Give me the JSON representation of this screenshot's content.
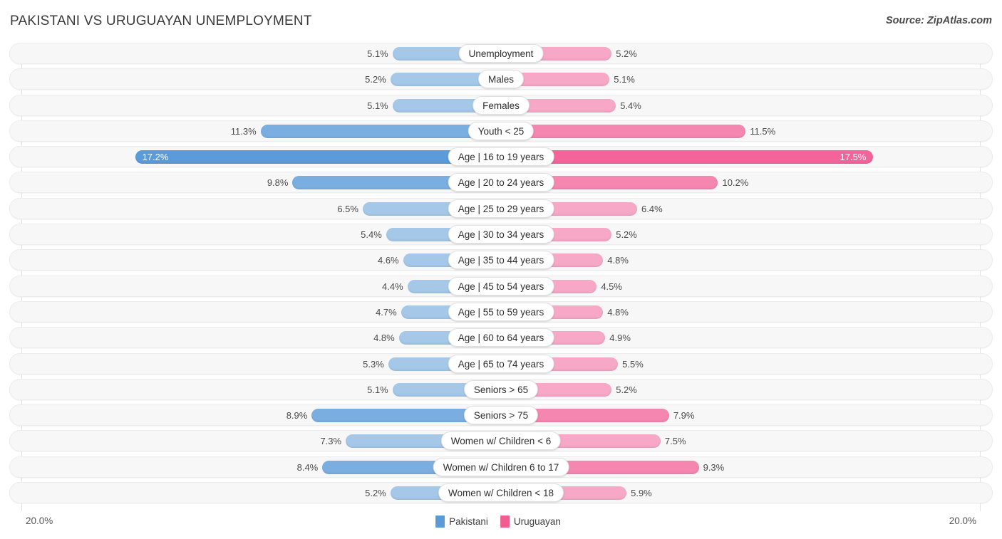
{
  "header": {
    "title": "PAKISTANI VS URUGUAYAN UNEMPLOYMENT",
    "source": "Source: ZipAtlas.com"
  },
  "axis": {
    "left_label": "20.0%",
    "right_label": "20.0%",
    "max": 20.0
  },
  "legend": {
    "items": [
      {
        "label": "Pakistani",
        "color": "#5b9bd5"
      },
      {
        "label": "Uruguayan",
        "color": "#ee5e8e"
      }
    ]
  },
  "colors": {
    "blue_light": "#a5c8e8",
    "blue_mid": "#7baee0",
    "blue_dark": "#5b9bd9",
    "pink_light": "#f6a8c6",
    "pink_mid": "#f486b0",
    "pink_dark": "#f2649a",
    "track": "#f7f7f7",
    "gridline": "#e3e3e3"
  },
  "chart_data": {
    "type": "bar",
    "orientation": "horizontal-diverging",
    "title": "PAKISTANI VS URUGUAYAN UNEMPLOYMENT",
    "xlabel": "",
    "ylabel": "",
    "xlim": [
      -20.0,
      20.0
    ],
    "grid": true,
    "legend_position": "bottom-center",
    "series": [
      {
        "name": "Pakistani",
        "side": "left",
        "color": "#5b9bd5",
        "values": [
          5.1,
          5.2,
          5.1,
          11.3,
          17.2,
          9.8,
          6.5,
          5.4,
          4.6,
          4.4,
          4.7,
          4.8,
          5.3,
          5.1,
          8.9,
          7.3,
          8.4,
          5.2
        ]
      },
      {
        "name": "Uruguayan",
        "side": "right",
        "color": "#ee5e8e",
        "values": [
          5.2,
          5.1,
          5.4,
          11.5,
          17.5,
          10.2,
          6.4,
          5.2,
          4.8,
          4.5,
          4.8,
          4.9,
          5.5,
          5.2,
          7.9,
          7.5,
          9.3,
          5.9
        ]
      }
    ],
    "categories": [
      "Unemployment",
      "Males",
      "Females",
      "Youth < 25",
      "Age | 16 to 19 years",
      "Age | 20 to 24 years",
      "Age | 25 to 29 years",
      "Age | 30 to 34 years",
      "Age | 35 to 44 years",
      "Age | 45 to 54 years",
      "Age | 55 to 59 years",
      "Age | 60 to 64 years",
      "Age | 65 to 74 years",
      "Seniors > 65",
      "Seniors > 75",
      "Women w/ Children < 6",
      "Women w/ Children 6 to 17",
      "Women w/ Children < 18"
    ],
    "rows": [
      {
        "label": "Unemployment",
        "left_value": 5.1,
        "left_text": "5.1%",
        "right_value": 5.2,
        "right_text": "5.2%",
        "emphasis": 0
      },
      {
        "label": "Males",
        "left_value": 5.2,
        "left_text": "5.2%",
        "right_value": 5.1,
        "right_text": "5.1%",
        "emphasis": 0
      },
      {
        "label": "Females",
        "left_value": 5.1,
        "left_text": "5.1%",
        "right_value": 5.4,
        "right_text": "5.4%",
        "emphasis": 0
      },
      {
        "label": "Youth < 25",
        "left_value": 11.3,
        "left_text": "11.3%",
        "right_value": 11.5,
        "right_text": "11.5%",
        "emphasis": 1
      },
      {
        "label": "Age | 16 to 19 years",
        "left_value": 17.2,
        "left_text": "17.2%",
        "right_value": 17.5,
        "right_text": "17.5%",
        "emphasis": 2
      },
      {
        "label": "Age | 20 to 24 years",
        "left_value": 9.8,
        "left_text": "9.8%",
        "right_value": 10.2,
        "right_text": "10.2%",
        "emphasis": 1
      },
      {
        "label": "Age | 25 to 29 years",
        "left_value": 6.5,
        "left_text": "6.5%",
        "right_value": 6.4,
        "right_text": "6.4%",
        "emphasis": 0
      },
      {
        "label": "Age | 30 to 34 years",
        "left_value": 5.4,
        "left_text": "5.4%",
        "right_value": 5.2,
        "right_text": "5.2%",
        "emphasis": 0
      },
      {
        "label": "Age | 35 to 44 years",
        "left_value": 4.6,
        "left_text": "4.6%",
        "right_value": 4.8,
        "right_text": "4.8%",
        "emphasis": 0
      },
      {
        "label": "Age | 45 to 54 years",
        "left_value": 4.4,
        "left_text": "4.4%",
        "right_value": 4.5,
        "right_text": "4.5%",
        "emphasis": 0
      },
      {
        "label": "Age | 55 to 59 years",
        "left_value": 4.7,
        "left_text": "4.7%",
        "right_value": 4.8,
        "right_text": "4.8%",
        "emphasis": 0
      },
      {
        "label": "Age | 60 to 64 years",
        "left_value": 4.8,
        "left_text": "4.8%",
        "right_value": 4.9,
        "right_text": "4.9%",
        "emphasis": 0
      },
      {
        "label": "Age | 65 to 74 years",
        "left_value": 5.3,
        "left_text": "5.3%",
        "right_value": 5.5,
        "right_text": "5.5%",
        "emphasis": 0
      },
      {
        "label": "Seniors > 65",
        "left_value": 5.1,
        "left_text": "5.1%",
        "right_value": 5.2,
        "right_text": "5.2%",
        "emphasis": 0
      },
      {
        "label": "Seniors > 75",
        "left_value": 8.9,
        "left_text": "8.9%",
        "right_value": 7.9,
        "right_text": "7.9%",
        "emphasis": 1
      },
      {
        "label": "Women w/ Children < 6",
        "left_value": 7.3,
        "left_text": "7.3%",
        "right_value": 7.5,
        "right_text": "7.5%",
        "emphasis": 0
      },
      {
        "label": "Women w/ Children 6 to 17",
        "left_value": 8.4,
        "left_text": "8.4%",
        "right_value": 9.3,
        "right_text": "9.3%",
        "emphasis": 1
      },
      {
        "label": "Women w/ Children < 18",
        "left_value": 5.2,
        "left_text": "5.2%",
        "right_value": 5.9,
        "right_text": "5.9%",
        "emphasis": 0
      }
    ]
  }
}
